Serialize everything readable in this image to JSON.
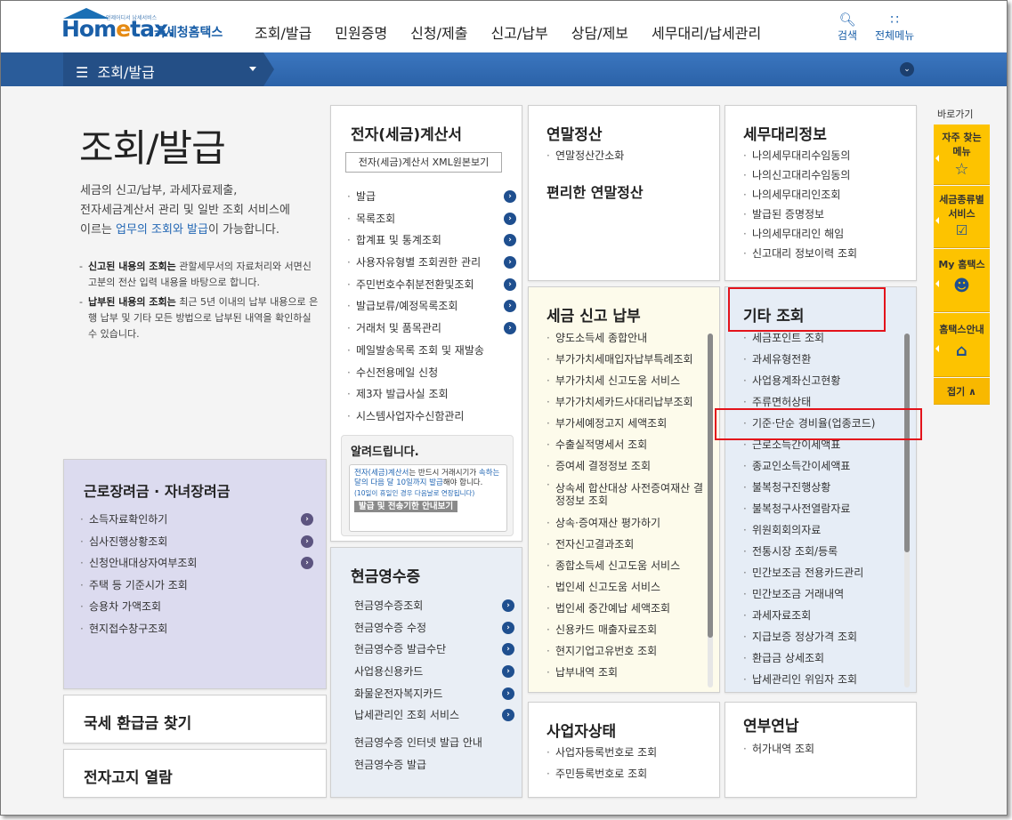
{
  "header": {
    "logo_small": "언제어디서 납세서비스",
    "logo_word_a": "Hom",
    "logo_word_e": "e",
    "logo_word_b": "tax.",
    "logo_kr": "국세청홈택스",
    "nav": [
      "조회/발급",
      "민원증명",
      "신청/제출",
      "신고/납부",
      "상담/제보",
      "세무대리/납세관리"
    ],
    "search_label": "검색",
    "allmenu_label": "전체메뉴"
  },
  "subbar": {
    "crumb": "조회/발급"
  },
  "intro": {
    "title": "조회/발급",
    "desc_1": "세금의 신고/납부, 과세자료제출,",
    "desc_2": "전자세금계산서 관리 및 일반 조회 서비스에",
    "desc_3a": "이르는 ",
    "desc_3b": "업무의 조회와 발급",
    "desc_3c": "이 가능합니다.",
    "note1_b": "신고된 내용의 조회는",
    "note1": " 관할세무서의 자료처리와 서면신고분의 전산 입력 내용을 바탕으로 합니다.",
    "note2_b": "납부된 내용의 조회는",
    "note2": " 최근 5년 이내의 납부 내용으로 은행 납부 및 기타 모든 방법으로 납부된 내역을 확인하실 수 있습니다."
  },
  "cards": {
    "einvoice": {
      "title": "전자(세금)계산서",
      "xml_button": "전자(세금)계산서 XML원본보기",
      "items": [
        "발급",
        "목록조회",
        "합계표 및 통계조회",
        "사용자유형별 조회권한 관리",
        "주민번호수취분전환및조회",
        "발급보류/예정목록조회",
        "거래처 및 품목관리",
        "메일발송목록 조회 및 재발송",
        "수신전용메일 신청",
        "제3자 발급사실 조회",
        "시스템사업자수신함관리"
      ],
      "notice_title": "알려드립니다.",
      "notice_text_a": "전자(세금)계산서",
      "notice_text_b": "는 반드시 거래시기가 ",
      "notice_text_c": "속하는 달의 다음 달 10일까지 발급",
      "notice_text_d": "해야 합니다.",
      "notice_sub": "(10일이 휴일인 경우 다음날로 연장됩니다)",
      "notice_button": "발급 및 전송기한 안내보기"
    },
    "yearend": {
      "title": "연말정산",
      "items": [
        "연말정산간소화"
      ],
      "subtitle": "편리한 연말정산"
    },
    "agent": {
      "title": "세무대리정보",
      "items": [
        "나의세무대리수임동의",
        "나의신고대리수임동의",
        "나의세무대리인조회",
        "발급된 증명정보",
        "나의세무대리인 해임",
        "신고대리 정보이력 조회"
      ]
    },
    "tax": {
      "title": "세금 신고 납부",
      "items": [
        "양도소득세 종합안내",
        "부가가치세매입자납부특례조회",
        "부가가치세 신고도움 서비스",
        "부가가치세카드사대리납부조회",
        "부가세예정고지 세액조회",
        "수출실적명세서 조회",
        "증여세 결정정보 조회",
        "상속세 합산대상 사전증여재산 결정정보 조회",
        "상속·증여재산 평가하기",
        "전자신고결과조회",
        "종합소득세 신고도움 서비스",
        "법인세 신고도움 서비스",
        "법인세 중간예납 세액조회",
        "신용카드 매출자료조회",
        "현지기업고유번호 조회",
        "납부내역 조회"
      ]
    },
    "etc": {
      "title": "기타 조회",
      "items": [
        "세금포인트 조회",
        "과세유형전환",
        "사업용계좌신고현황",
        "주류면허상태",
        "기준·단순 경비율(업종코드)",
        "근로소득간이세액표",
        "종교인소득간이세액표",
        "불복청구진행상황",
        "불복청구사전열람자료",
        "위원회회의자료",
        "전통시장 조회/등록",
        "민간보조금 전용카드관리",
        "민간보조금 거래내역",
        "과세자료조회",
        "지급보증 정상가격 조회",
        "환급금 상세조회",
        "납세관리인 위임자 조회"
      ]
    },
    "cash": {
      "title": "현금영수증",
      "items": [
        "현금영수증조회",
        "현금영수증 수정",
        "현금영수증 발급수단",
        "사업용신용카드",
        "화물운전자복지카드",
        "납세관리인 조회 서비스"
      ],
      "links": [
        "현금영수증 인터넷 발급 안내",
        "현금영수증 발급"
      ]
    },
    "biz": {
      "title": "사업자상태",
      "items": [
        "사업자등록번호로 조회",
        "주민등록번호로 조회"
      ]
    },
    "pension": {
      "title": "연부연납",
      "items": [
        "허가내역 조회"
      ]
    },
    "worker": {
      "title": "근로장려금 · 자녀장려금",
      "items": [
        "소득자료확인하기",
        "심사진행상황조회",
        "신청안내대상자여부조회",
        "주택 등 기준시가 조회",
        "승용차 가액조회",
        "현지접수창구조회"
      ]
    },
    "refund": {
      "title": "국세 환급금 찾기"
    },
    "ebill": {
      "title": "전자고지 열람"
    }
  },
  "quick": {
    "title": "바로가기",
    "items": [
      {
        "label_1": "자주 찾는",
        "label_2": "메뉴",
        "icon": "star-icon"
      },
      {
        "label_1": "세금종류별",
        "label_2": "서비스",
        "icon": "checkbox-icon"
      },
      {
        "label_1": "My 홈택스",
        "label_2": "",
        "icon": "user-icon"
      },
      {
        "label_1": "홈택스안내",
        "label_2": "",
        "icon": "home-icon"
      }
    ],
    "fold": "접기 ∧"
  },
  "colors": {
    "brand": "#1a5fa8",
    "accent": "#fdc300",
    "highlight": "#e3131b"
  }
}
